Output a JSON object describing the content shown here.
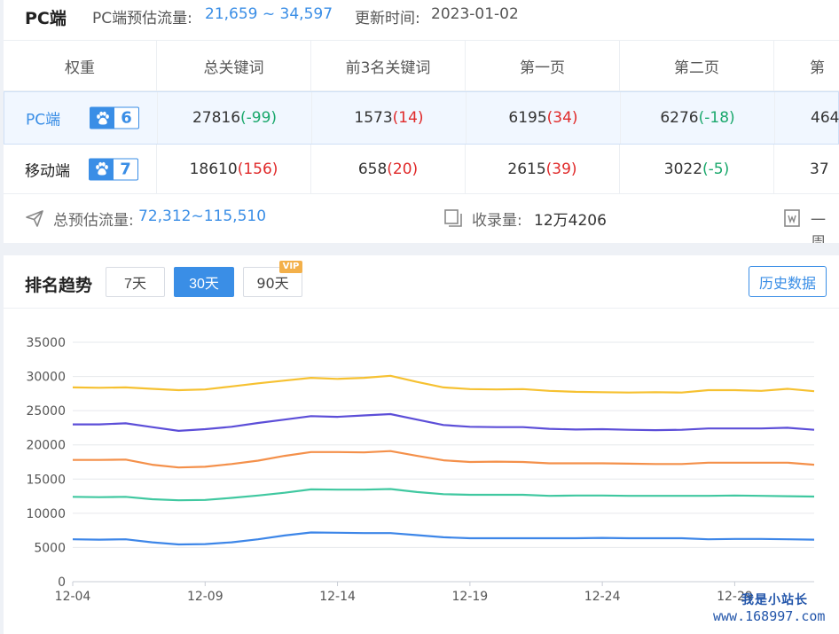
{
  "header": {
    "title": "PC端",
    "traffic_label": "PC端预估流量:",
    "traffic_value": "21,659 ~ 34,597",
    "update_label": "更新时间:",
    "update_value": "2023-01-02"
  },
  "table": {
    "columns": [
      "权重",
      "总关键词",
      "前3名关键词",
      "第一页",
      "第二页",
      "第"
    ],
    "rows": [
      {
        "name": "PC端",
        "weight": "6",
        "cells": [
          {
            "v": "27816",
            "d": "(-99)",
            "dir": "down"
          },
          {
            "v": "1573",
            "d": "(14)",
            "dir": "up"
          },
          {
            "v": "6195",
            "d": "(34)",
            "dir": "up"
          },
          {
            "v": "6276",
            "d": "(-18)",
            "dir": "down"
          },
          {
            "v": "464",
            "d": "",
            "dir": ""
          }
        ]
      },
      {
        "name": "移动端",
        "weight": "7",
        "cells": [
          {
            "v": "18610",
            "d": "(156)",
            "dir": "up"
          },
          {
            "v": "658",
            "d": "(20)",
            "dir": "up"
          },
          {
            "v": "2615",
            "d": "(39)",
            "dir": "up"
          },
          {
            "v": "3022",
            "d": "(-5)",
            "dir": "down"
          },
          {
            "v": "37",
            "d": "",
            "dir": ""
          }
        ]
      }
    ]
  },
  "summary": {
    "total_traffic_label": "总预估流量:",
    "total_traffic_value": "72,312~115,510",
    "indexed_label": "收录量:",
    "indexed_value": "12万4206",
    "cut_label": "一周"
  },
  "trend": {
    "title": "排名趋势",
    "ranges": [
      "7天",
      "30天",
      "90天"
    ],
    "active_range": "30天",
    "vip_badge": "VIP",
    "history_button": "历史数据"
  },
  "watermark": {
    "line1": "我是小站长",
    "line2": "www.168997.com"
  },
  "colors": {
    "accent": "#3a8ee6",
    "up": "#e02a2a",
    "down": "#1aa86c"
  },
  "chart_data": {
    "type": "line",
    "x": [
      "12-04",
      "12-05",
      "12-06",
      "12-07",
      "12-08",
      "12-09",
      "12-10",
      "12-11",
      "12-12",
      "12-13",
      "12-14",
      "12-15",
      "12-16",
      "12-17",
      "12-18",
      "12-19",
      "12-20",
      "12-21",
      "12-22",
      "12-23",
      "12-24",
      "12-25",
      "12-26",
      "12-27",
      "12-28",
      "12-29",
      "12-30",
      "12-31",
      "01-01"
    ],
    "x_tick_labels": [
      "12-04",
      "12-09",
      "12-14",
      "12-19",
      "12-24",
      "12-29"
    ],
    "ylim": [
      0,
      35000
    ],
    "yticks": [
      0,
      5000,
      10000,
      15000,
      20000,
      25000,
      30000,
      35000
    ],
    "grid": true,
    "series": [
      {
        "color": "#f6c131",
        "values": [
          28400,
          28350,
          28400,
          28200,
          28000,
          28100,
          28550,
          29000,
          29400,
          29800,
          29650,
          29800,
          30100,
          29200,
          28400,
          28150,
          28100,
          28150,
          27900,
          27750,
          27700,
          27650,
          27700,
          27650,
          28000,
          28000,
          27900,
          28200,
          27850
        ]
      },
      {
        "color": "#5c4ed8",
        "values": [
          23000,
          23000,
          23150,
          22600,
          22050,
          22300,
          22650,
          23200,
          23700,
          24200,
          24100,
          24300,
          24500,
          23700,
          22900,
          22650,
          22600,
          22600,
          22350,
          22250,
          22300,
          22200,
          22150,
          22200,
          22400,
          22400,
          22400,
          22500,
          22200
        ]
      },
      {
        "color": "#f4904a",
        "values": [
          17800,
          17800,
          17850,
          17100,
          16700,
          16800,
          17200,
          17700,
          18400,
          18950,
          18950,
          18900,
          19100,
          18400,
          17750,
          17500,
          17550,
          17500,
          17300,
          17300,
          17300,
          17250,
          17200,
          17200,
          17400,
          17400,
          17400,
          17400,
          17100
        ]
      },
      {
        "color": "#40c8a0",
        "values": [
          12400,
          12350,
          12400,
          12050,
          11900,
          11950,
          12250,
          12600,
          13000,
          13500,
          13450,
          13450,
          13550,
          13100,
          12800,
          12700,
          12700,
          12700,
          12550,
          12600,
          12600,
          12550,
          12550,
          12550,
          12550,
          12600,
          12550,
          12500,
          12450
        ]
      },
      {
        "color": "#3d86e8",
        "values": [
          6200,
          6150,
          6200,
          5750,
          5450,
          5500,
          5750,
          6200,
          6750,
          7200,
          7150,
          7100,
          7100,
          6800,
          6500,
          6350,
          6350,
          6350,
          6350,
          6350,
          6400,
          6350,
          6350,
          6350,
          6200,
          6250,
          6250,
          6200,
          6150
        ]
      }
    ]
  }
}
